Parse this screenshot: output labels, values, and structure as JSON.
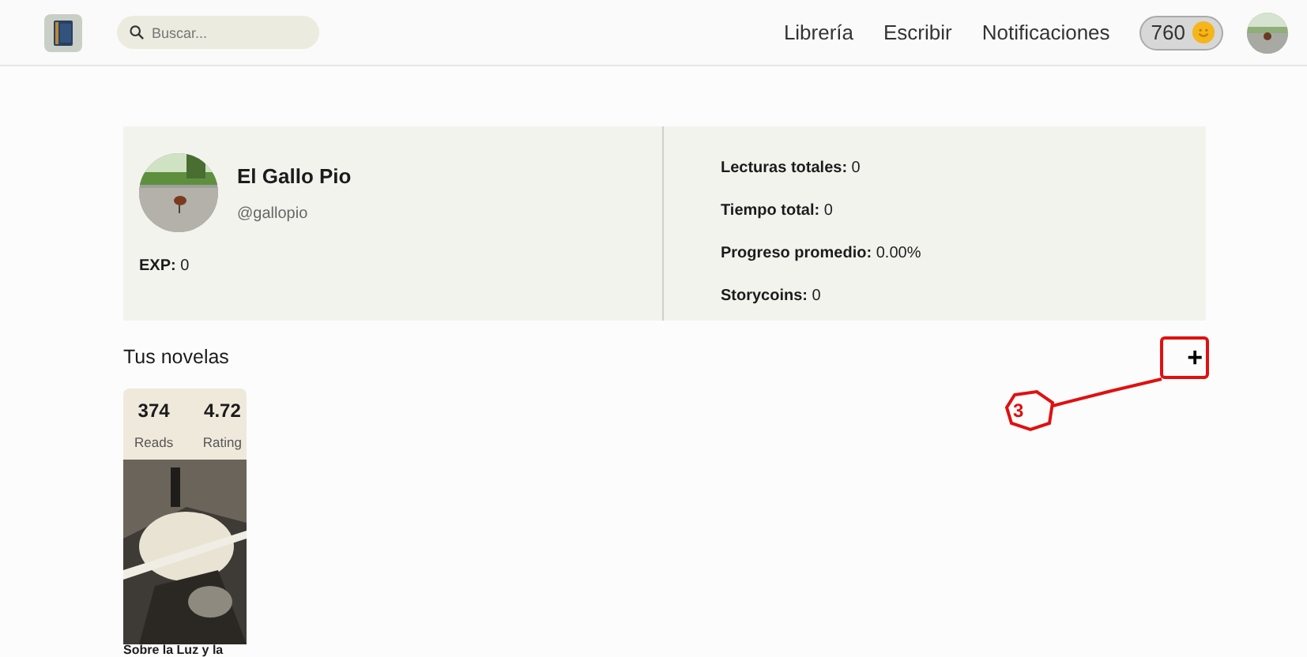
{
  "navbar": {
    "search": {
      "placeholder": "Buscar..."
    },
    "links": [
      "Librería",
      "Escribir",
      "Notificaciones"
    ],
    "coins": "760"
  },
  "profile": {
    "name": "El Gallo Pio",
    "handle": "@gallopio",
    "exp": {
      "label": "EXP:",
      "value": "0"
    },
    "stats": [
      {
        "label": "Lecturas totales:",
        "value": "0"
      },
      {
        "label": "Tiempo total:",
        "value": "0"
      },
      {
        "label": "Progreso promedio:",
        "value": "0.00%"
      },
      {
        "label": "Storycoins:",
        "value": "0"
      }
    ]
  },
  "novels": {
    "title": "Tus novelas",
    "add_button": "+",
    "items": [
      {
        "reads": "374",
        "reads_label": "Reads",
        "rating": "4.72",
        "rating_label": "Rating",
        "title": "Sobre la Luz y la"
      }
    ]
  },
  "annotation": {
    "number": "3"
  }
}
